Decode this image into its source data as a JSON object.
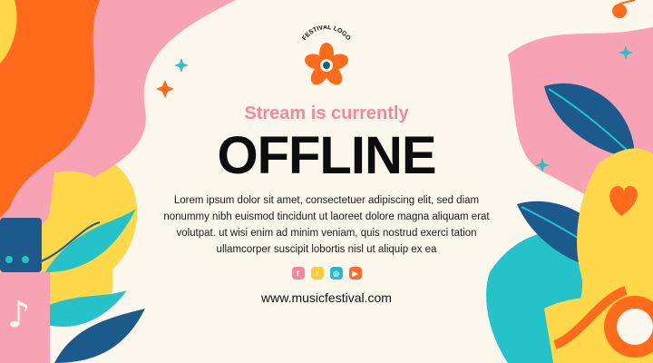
{
  "logo": {
    "text": "FESTIVAL LOGO",
    "icon": "flower-icon"
  },
  "headline": {
    "subtitle": "Stream is currently",
    "title": "OFFLINE"
  },
  "description": "Lorem ipsum dolor sit amet, consectetuer adipiscing elit, sed diam nonummy nibh euismod tincidunt ut laoreet dolore magna aliquam erat volutpat. ut wisi enim ad minim veniam, quis nostrud exerci tation ullamcorper suscipit lobortis nisl ut aliquip ex ea",
  "social": [
    {
      "name": "facebook-icon",
      "glyph": "f",
      "color": "#f4879b"
    },
    {
      "name": "twitter-icon",
      "glyph": "t",
      "color": "#ffc93c"
    },
    {
      "name": "instagram-icon",
      "glyph": "◎",
      "color": "#25b9c9"
    },
    {
      "name": "youtube-icon",
      "glyph": "▶",
      "color": "#ff6b2b"
    }
  ],
  "website": "www.musicfestival.com",
  "colors": {
    "background": "#fbf7ec",
    "orange": "#ff6b1a",
    "pink": "#f7a3b5",
    "yellow": "#ffd84a",
    "teal": "#25c2c9",
    "navy": "#1d5a8c"
  }
}
